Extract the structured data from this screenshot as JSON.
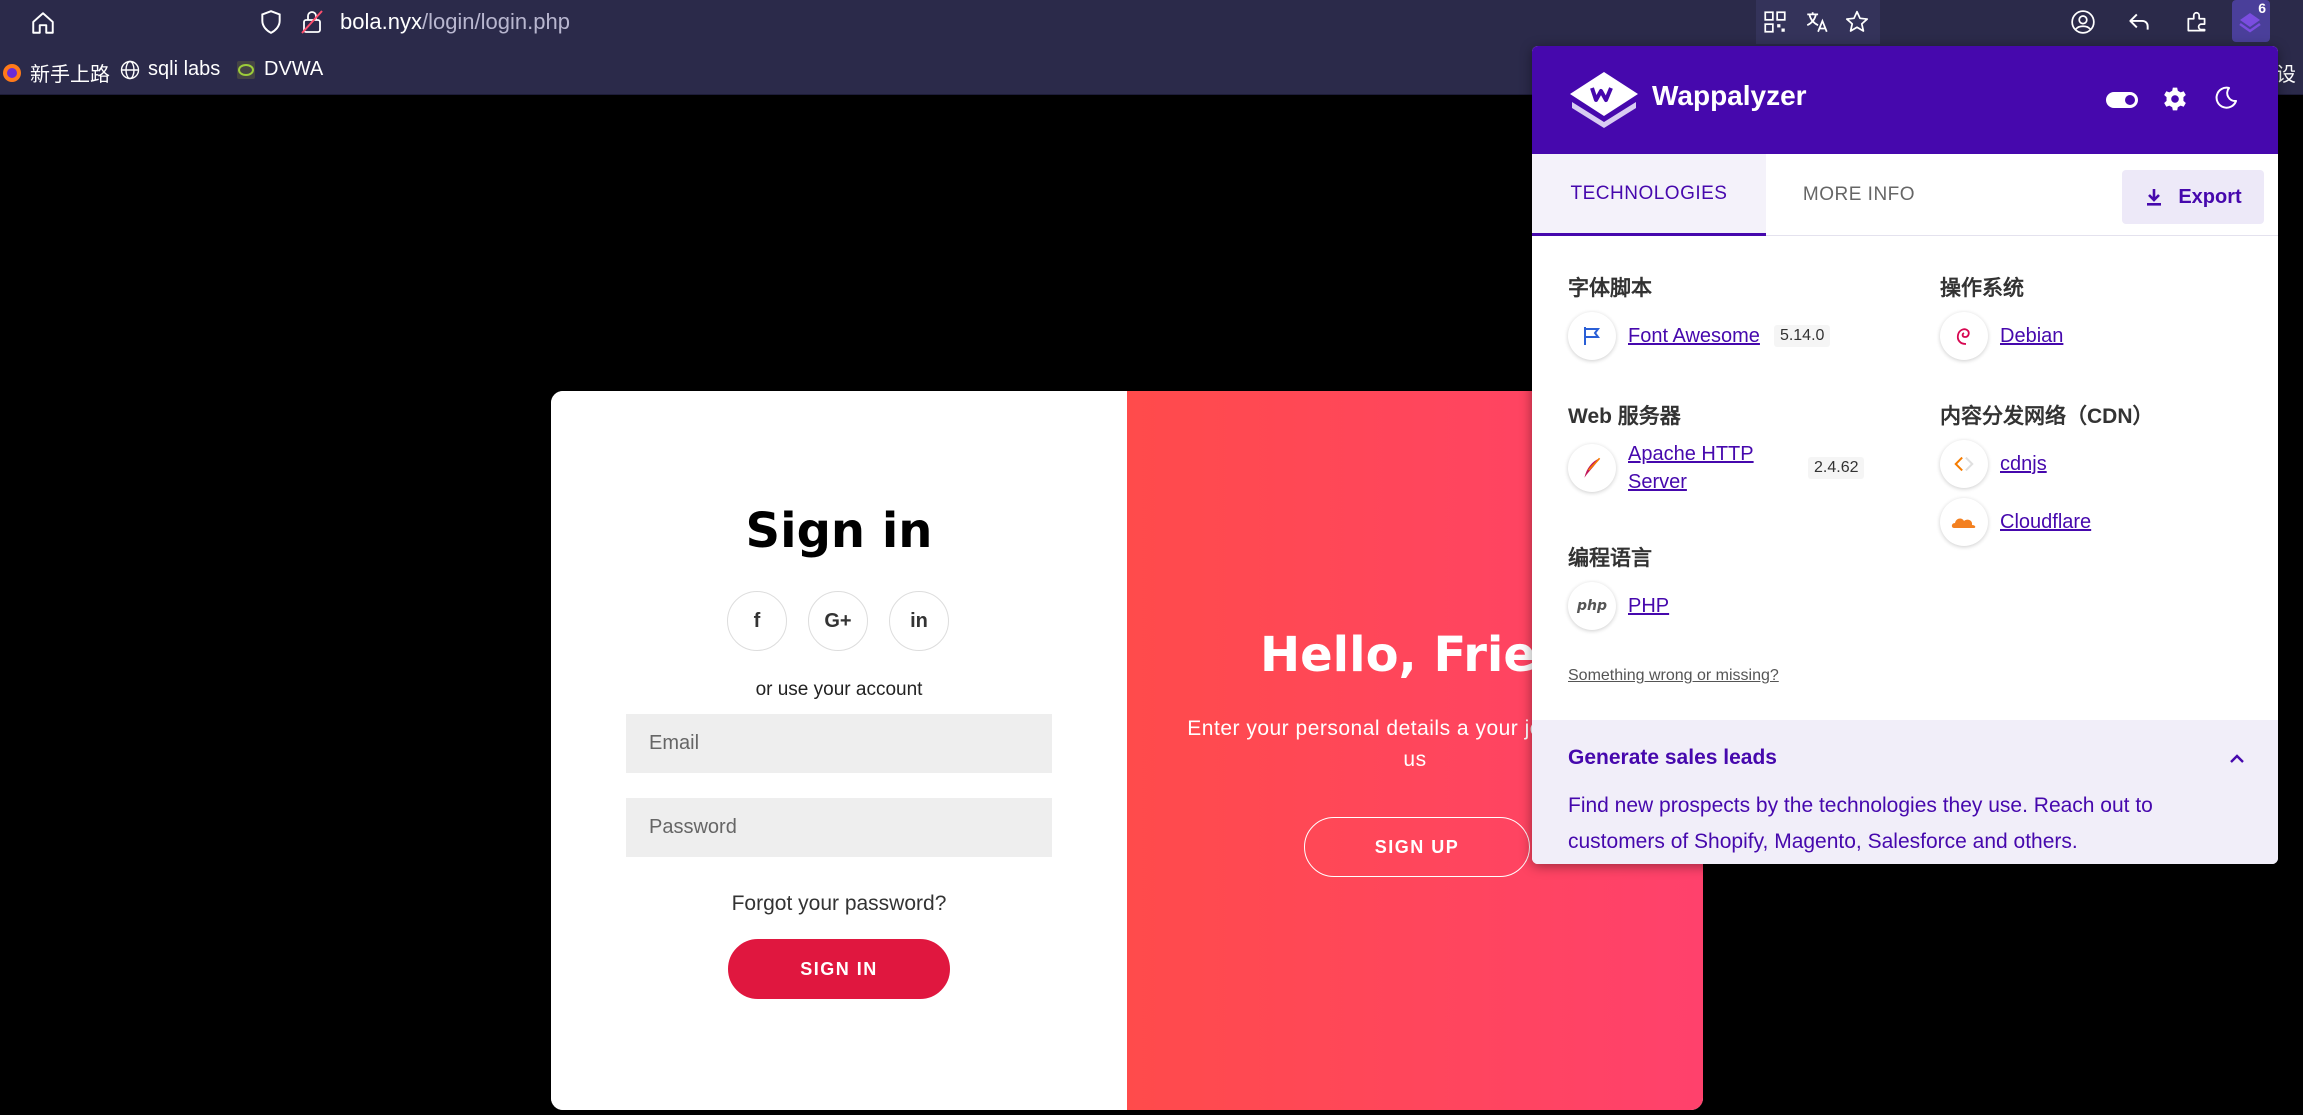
{
  "browser": {
    "url_host": "bola.nyx",
    "url_path": "/login/login.php",
    "extension_badge": "6",
    "bookmarks": [
      "新手上路",
      "sqli labs",
      "DVWA"
    ],
    "bookmark_overflow": "设"
  },
  "page": {
    "signin_title": "Sign in",
    "social": [
      "f",
      "G+",
      "in"
    ],
    "or_text": "or use your account",
    "email_placeholder": "Email",
    "password_placeholder": "Password",
    "forgot": "Forgot your password?",
    "signin_button": "SIGN IN",
    "hello_title": "Hello, Frien",
    "hello_desc": "Enter your personal details a your journey with us",
    "signup_button": "SIGN UP"
  },
  "wappalyzer": {
    "title": "Wappalyzer",
    "tabs": [
      "TECHNOLOGIES",
      "MORE INFO"
    ],
    "export": "Export",
    "categories": [
      {
        "name": "字体脚本",
        "items": [
          {
            "name": "Font Awesome",
            "version": "5.14.0",
            "icon": "font-awesome-flag-icon"
          }
        ]
      },
      {
        "name": "Web 服务器",
        "items": [
          {
            "name": "Apache HTTP Server",
            "version": "2.4.62",
            "icon": "apache-feather-icon"
          }
        ]
      },
      {
        "name": "编程语言",
        "items": [
          {
            "name": "PHP",
            "version": "",
            "icon": "php-icon"
          }
        ]
      },
      {
        "name": "操作系统",
        "items": [
          {
            "name": "Debian",
            "version": "",
            "icon": "debian-swirl-icon"
          }
        ]
      },
      {
        "name": "内容分发网络（CDN）",
        "items": [
          {
            "name": "cdnjs",
            "version": "",
            "icon": "cdnjs-icon"
          },
          {
            "name": "Cloudflare",
            "version": "",
            "icon": "cloudflare-cloud-icon"
          }
        ]
      }
    ],
    "something_wrong": "Something wrong or missing?",
    "leads_title": "Generate sales leads",
    "leads_text": "Find new prospects by the technologies they use. Reach out to customers of Shopify, Magento, Salesforce and others."
  },
  "colors": {
    "chrome": "#2b2a4a",
    "wappalyzer_purple": "#4608ad",
    "signin_red": "#e0173f",
    "panel_gradient_start": "#ff4b4b",
    "panel_gradient_end": "#ff416c"
  }
}
